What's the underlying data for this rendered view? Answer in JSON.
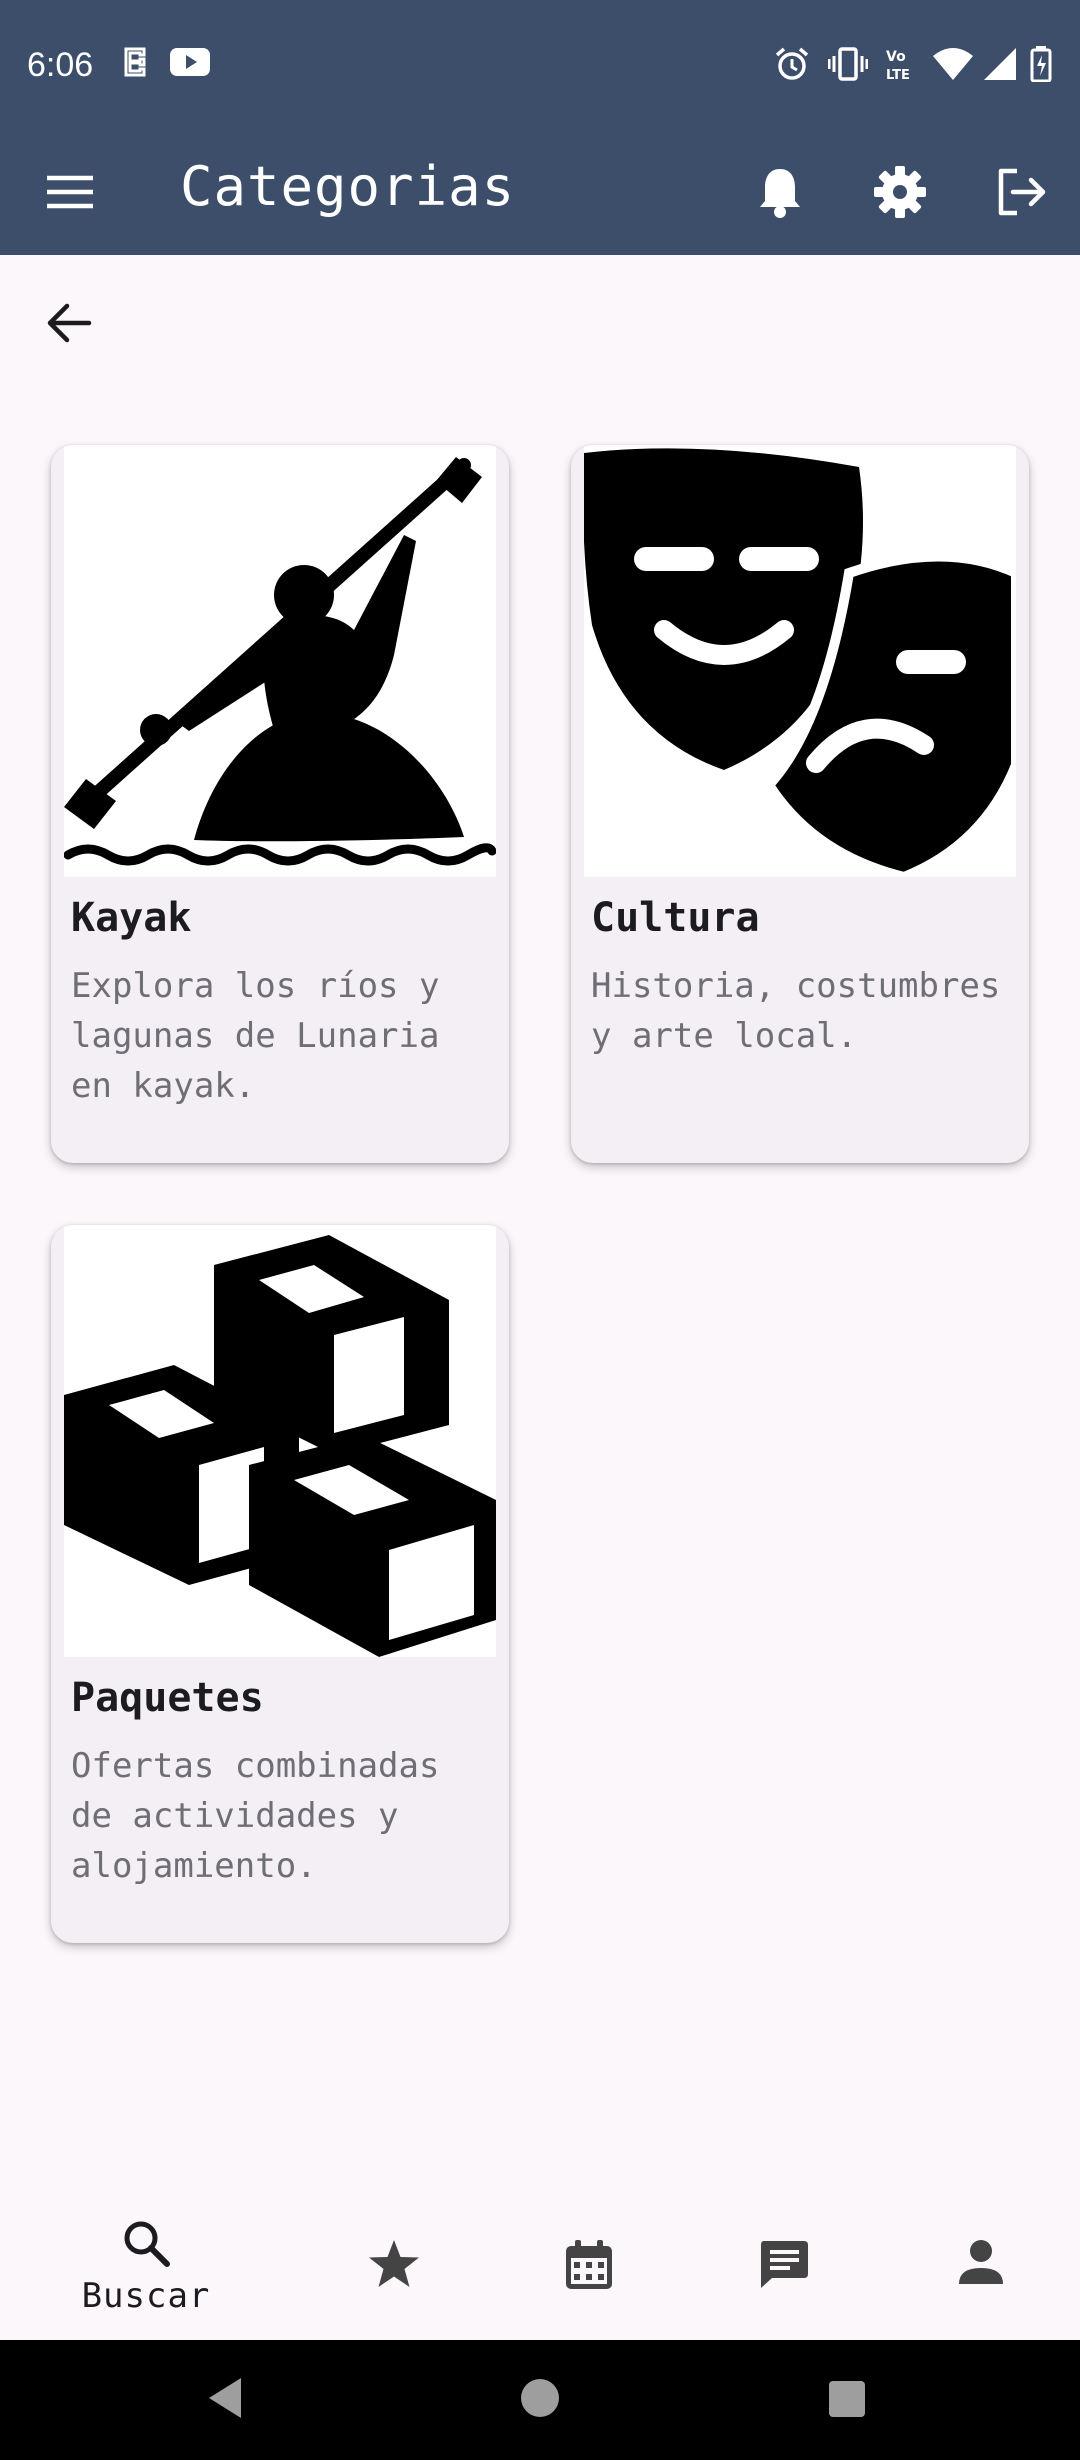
{
  "status_bar": {
    "time": "6:06",
    "icons": [
      "notification-icon",
      "youtube-icon",
      "alarm-icon",
      "vibrate-icon",
      "volte-icon",
      "wifi-icon",
      "signal-icon",
      "battery-icon"
    ]
  },
  "app_bar": {
    "title": "Categorias",
    "icons": [
      "menu-icon",
      "bell-icon",
      "gear-icon",
      "logout-icon"
    ],
    "background": "#3c4e6a"
  },
  "cards": [
    {
      "title": "Kayak",
      "description": "Explora los ríos y lagunas de Lunaria en kayak.",
      "image": "kayak-image"
    },
    {
      "title": "Cultura",
      "description": "Historia, costumbres y arte local.",
      "image": "theater-masks-image"
    },
    {
      "title": "Paquetes",
      "description": "Ofertas combinadas de actividades y alojamiento.",
      "image": "boxes-image"
    }
  ],
  "bottom_nav": {
    "items": [
      {
        "label": "Buscar",
        "icon": "search-icon",
        "active": true
      },
      {
        "label": "",
        "icon": "star-icon",
        "active": false
      },
      {
        "label": "",
        "icon": "calendar-icon",
        "active": false
      },
      {
        "label": "",
        "icon": "chat-icon",
        "active": false
      },
      {
        "label": "",
        "icon": "person-icon",
        "active": false
      }
    ]
  },
  "system_nav": {
    "icons": [
      "back-triangle-icon",
      "home-circle-icon",
      "recents-square-icon"
    ]
  }
}
